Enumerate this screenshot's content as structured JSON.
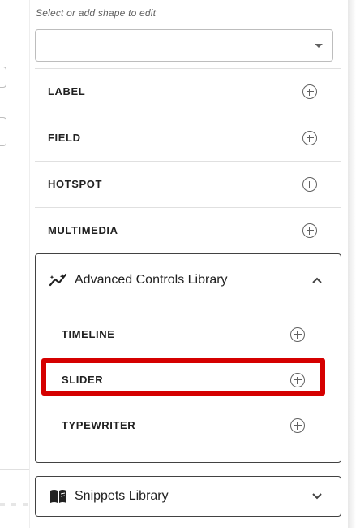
{
  "panel": {
    "hint": "Select or add shape to edit",
    "select_value": ""
  },
  "shapes": [
    {
      "label": "LABEL"
    },
    {
      "label": "FIELD"
    },
    {
      "label": "HOTSPOT"
    },
    {
      "label": "MULTIMEDIA"
    }
  ],
  "advanced": {
    "title": "Advanced Controls Library",
    "expanded": true,
    "items": [
      {
        "label": "TIMELINE"
      },
      {
        "label": "SLIDER",
        "highlighted": true
      },
      {
        "label": "TYPEWRITER"
      }
    ]
  },
  "snippets": {
    "title": "Snippets Library",
    "expanded": false
  },
  "colors": {
    "highlight": "#d50000",
    "text": "#212121",
    "icon": "#616161"
  }
}
